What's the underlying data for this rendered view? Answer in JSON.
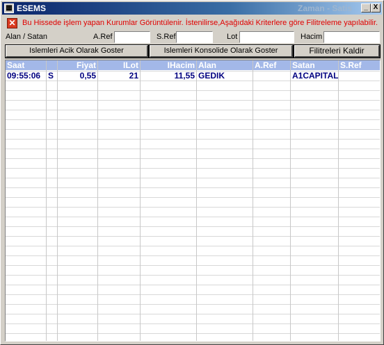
{
  "window": {
    "icon": "app-icon",
    "title": "ESEMS",
    "title_right": "Zaman - Satis",
    "minimize": "_",
    "close": "X"
  },
  "info": {
    "icon": "error-x-icon",
    "text": "Bu Hissede işlem yapan Kurumlar Görüntülenir. İstenilirse,Aşağıdaki Kriterlere göre Filitreleme yapılabilir."
  },
  "filters": {
    "alan_satan_label": "Alan / Satan",
    "aref_label": "A.Ref",
    "sref_label": "S.Ref",
    "lot_label": "Lot",
    "hacim_label": "Hacim",
    "alan_satan_value": "",
    "aref_value": "",
    "sref_value": "",
    "lot_value": "",
    "hacim_value": ""
  },
  "buttons": {
    "acik": "Islemleri Acik Olarak Goster",
    "konsolide": "Islemleri Konsolide Olarak Goster",
    "kaldir": "Filitreleri Kaldir"
  },
  "table": {
    "columns": [
      "Saat",
      "",
      "Fiyat",
      "ILot",
      "IHacim",
      "Alan",
      "A.Ref",
      "Satan",
      "S.Ref"
    ],
    "rows": [
      [
        "09:55:06",
        "S",
        "0,55",
        "21",
        "11,55",
        "GEDIK",
        "",
        "A1CAPITAL",
        ""
      ]
    ]
  }
}
